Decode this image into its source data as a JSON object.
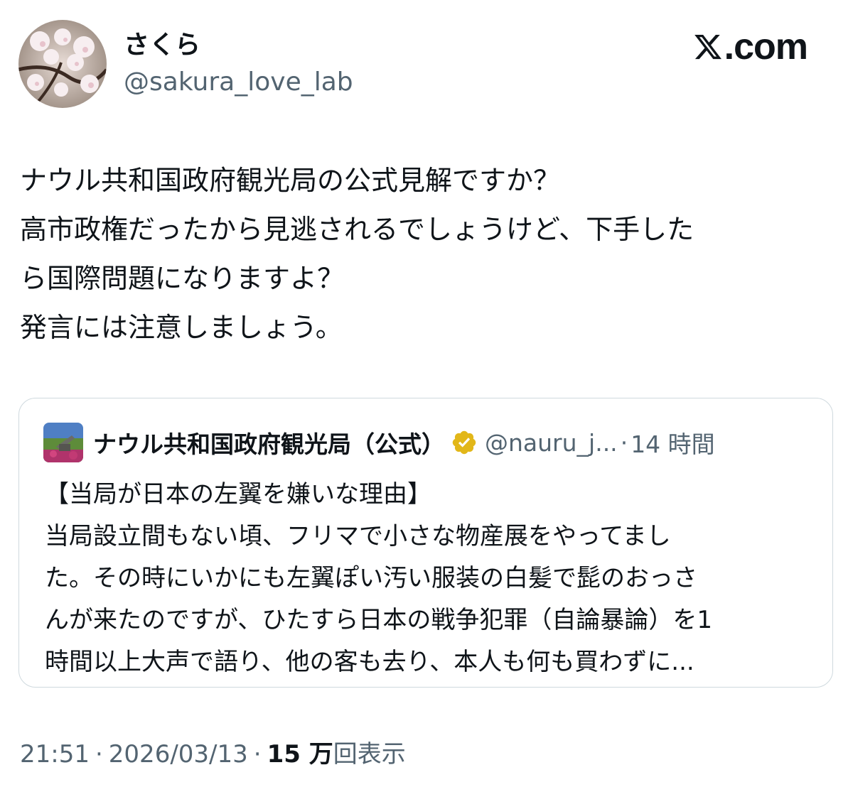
{
  "author": {
    "display_name": "さくら",
    "handle": "@sakura_love_lab"
  },
  "brand": {
    "text": ".com",
    "icon": "x-logo-icon"
  },
  "tweet": {
    "lines": [
      "ナウル共和国政府観光局の公式見解ですか？",
      "高市政権だったから見逃されるでしょうけど、下手した",
      "ら国際問題になりますよ？",
      "発言には注意しましょう。"
    ]
  },
  "quote": {
    "name": "ナウル共和国政府観光局（公式）",
    "handle": "@nauru_j...",
    "separator": "·",
    "time": "14 時間",
    "verified_icon": "verified-gold-badge-icon",
    "lines": [
      "【当局が日本の左翼を嫌いな理由】",
      "当局設立間もない頃、フリマで小さな物産展をやってまし",
      "た。その時にいかにも左翼ぽい汚い服装の白髪で髭のおっさ",
      "んが来たのですが、ひたすら日本の戦争犯罪（自論暴論）を1",
      "時間以上大声で語り、他の客も去り、本人も何も買わずに..."
    ]
  },
  "footer": {
    "time": "21:51",
    "separator": "·",
    "date": "2026/03/13",
    "views_count": "15 万",
    "views_label": "回表示"
  },
  "colors": {
    "text_primary": "#0f1419",
    "text_secondary": "#536471",
    "border": "#cfd9de",
    "verified_gold": "#e2b719"
  }
}
